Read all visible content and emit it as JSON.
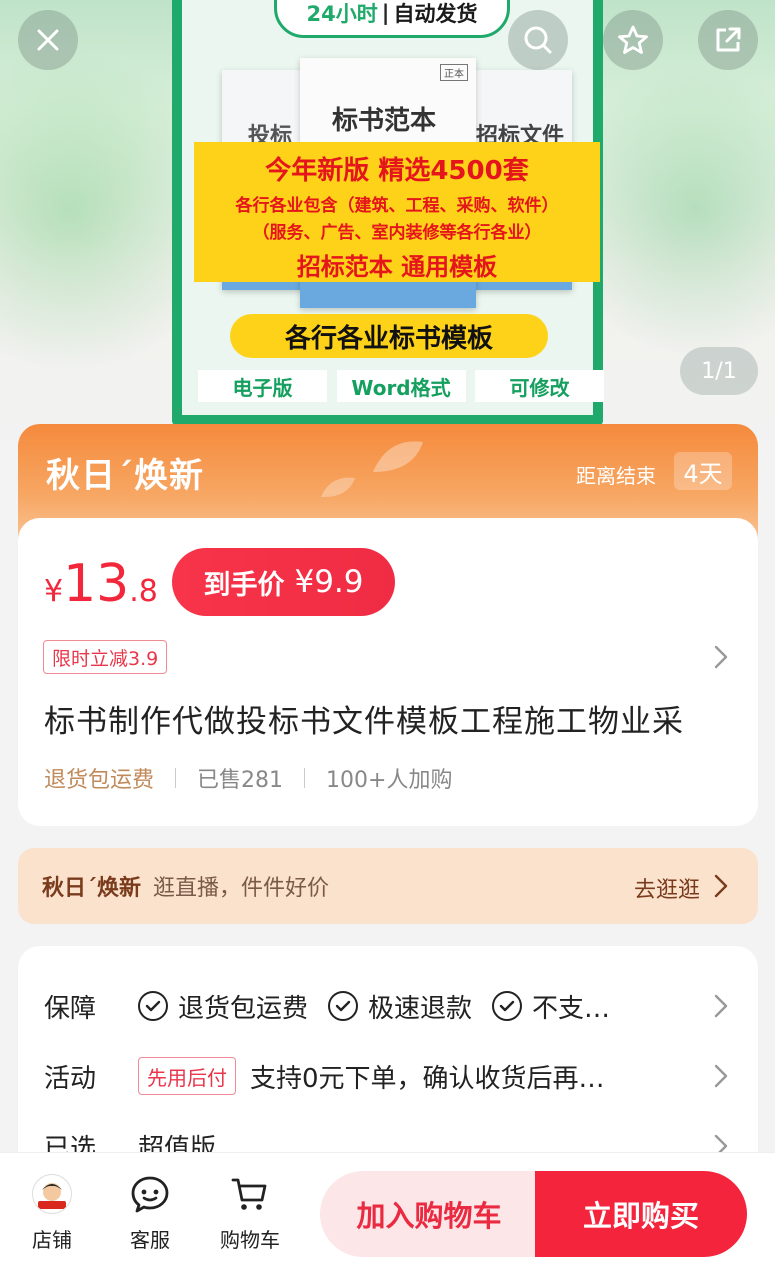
{
  "hero": {
    "image": {
      "header_prefix": "24小时",
      "header_sep": "|",
      "header_suffix": "自动发货",
      "doc_mid_title": "标书范本",
      "doc_mid_tag": "正本",
      "doc_left_title": "投标",
      "doc_right_title": "招标文件",
      "band_line1": "今年新版  精选4500套",
      "band_line2": "各行各业包含（建筑、工程、采购、软件）",
      "band_line3": "（服务、广告、室内装修等各行各业）",
      "band_line4": "招标范本  通用模板",
      "pill_text": "各行各业标书模板",
      "features": [
        "电子版",
        "Word格式",
        "可修改"
      ]
    },
    "page_indicator": "1/1"
  },
  "promo": {
    "title": "秋日´焕新",
    "countdown_label": "距离结束",
    "countdown_days": "4天"
  },
  "price": {
    "currency": "¥",
    "int": "13",
    "dec": ".8",
    "final_label": "到手价",
    "final_value": "¥9.9",
    "discount_tag": "限时立减3.9"
  },
  "product": {
    "title": "标书制作代做投标书文件模板工程施工物业采",
    "free_return": "退货包运费",
    "sold": "已售281",
    "carted": "100+人加购"
  },
  "live": {
    "brand": "秋日´焕新",
    "text": "逛直播，件件好价",
    "go": "去逛逛"
  },
  "info": {
    "guarantee_label": "保障",
    "guarantees": [
      "退货包运费",
      "极速退款",
      "不支…"
    ],
    "activity_label": "活动",
    "activity_tag": "先用后付",
    "activity_text": "支持0元下单，确认收货后再…",
    "selected_label": "已选",
    "selected_value": "超值版"
  },
  "bottom": {
    "shop": "店铺",
    "service": "客服",
    "cart": "购物车",
    "add_cart": "加入购物车",
    "buy_now": "立即购买"
  },
  "colors": {
    "accent_red": "#f4243d",
    "promo_orange": "#f58a3c",
    "product_green": "#1fa96a"
  }
}
